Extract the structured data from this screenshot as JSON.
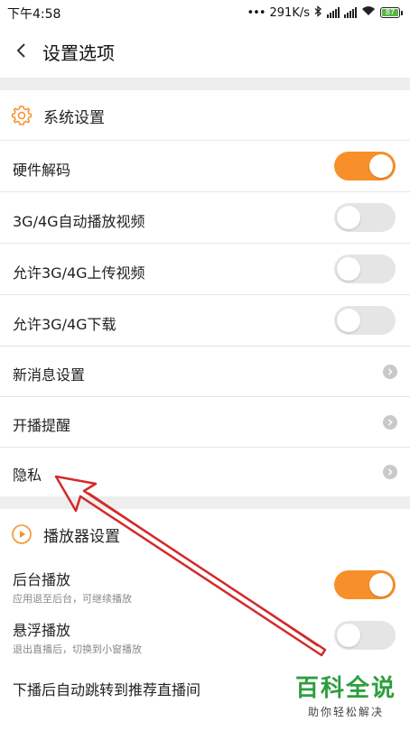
{
  "status_bar": {
    "time": "下午4:58",
    "net_speed": "291K/s",
    "battery": "87"
  },
  "header": {
    "title": "设置选项"
  },
  "sections": {
    "system": {
      "title": "系统设置",
      "rows": [
        {
          "label": "硬件解码",
          "control": "toggle",
          "on": true
        },
        {
          "label": "3G/4G自动播放视频",
          "control": "toggle",
          "on": false
        },
        {
          "label": "允许3G/4G上传视频",
          "control": "toggle",
          "on": false
        },
        {
          "label": "允许3G/4G下载",
          "control": "toggle",
          "on": false
        },
        {
          "label": "新消息设置",
          "control": "chevron"
        },
        {
          "label": "开播提醒",
          "control": "chevron"
        },
        {
          "label": "隐私",
          "control": "chevron"
        }
      ]
    },
    "player": {
      "title": "播放器设置",
      "rows": [
        {
          "label": "后台播放",
          "sub": "应用退至后台，可继续播放",
          "control": "toggle",
          "on": true
        },
        {
          "label": "悬浮播放",
          "sub": "退出直播后，切换到小窗播放",
          "control": "toggle",
          "on": false
        },
        {
          "label": "下播后自动跳转到推荐直播间"
        }
      ]
    }
  },
  "watermark": {
    "big": "百科全说",
    "small": "助你轻松解决"
  },
  "colors": {
    "accent": "#f7902a",
    "toggle_off": "#e5e5e5",
    "arrow": "#d42a2a",
    "divider": "#eeeeee"
  }
}
